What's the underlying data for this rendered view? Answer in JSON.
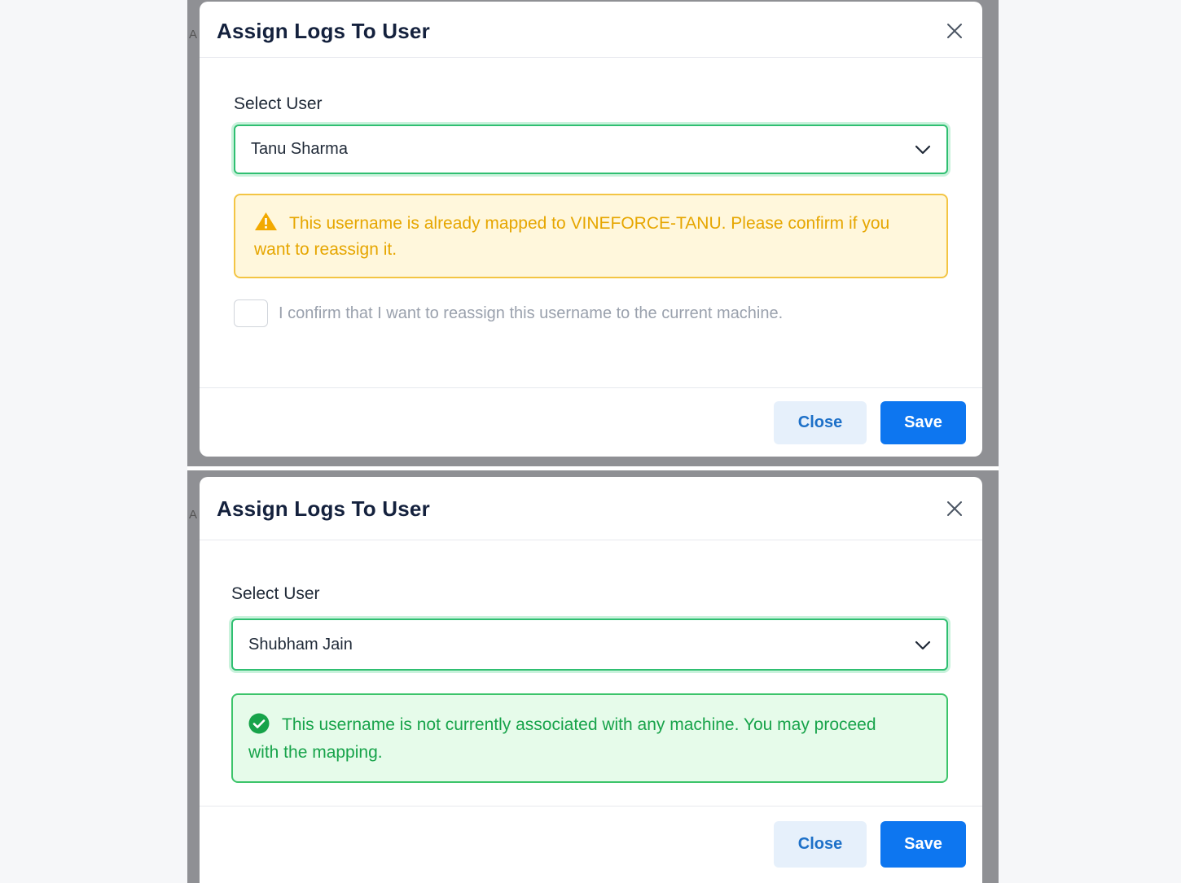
{
  "dialogs": [
    {
      "background_hint": "A",
      "title": "Assign Logs To User",
      "select_label": "Select User",
      "selected_user": "Tanu Sharma",
      "alert": {
        "type": "warning",
        "text": "This username is already mapped to VINEFORCE-TANU. Please confirm if you want to reassign it."
      },
      "confirm_label": "I confirm that I want to reassign this username to the current machine.",
      "close_label": "Close",
      "save_label": "Save"
    },
    {
      "background_hint": "A",
      "title": "Assign Logs To User",
      "select_label": "Select User",
      "selected_user": "Shubham Jain",
      "alert": {
        "type": "success",
        "text": "This username is not currently associated with any machine. You may proceed with the mapping."
      },
      "close_label": "Close",
      "save_label": "Save"
    }
  ],
  "colors": {
    "accent": "#0d76f0",
    "select_border": "#2fbf71",
    "warning": "#e6a600",
    "success": "#17a34a"
  },
  "icons": {
    "close": "close-icon",
    "dropdown": "chevron-down-icon",
    "warning": "warning-triangle-icon",
    "success": "check-circle-icon"
  }
}
